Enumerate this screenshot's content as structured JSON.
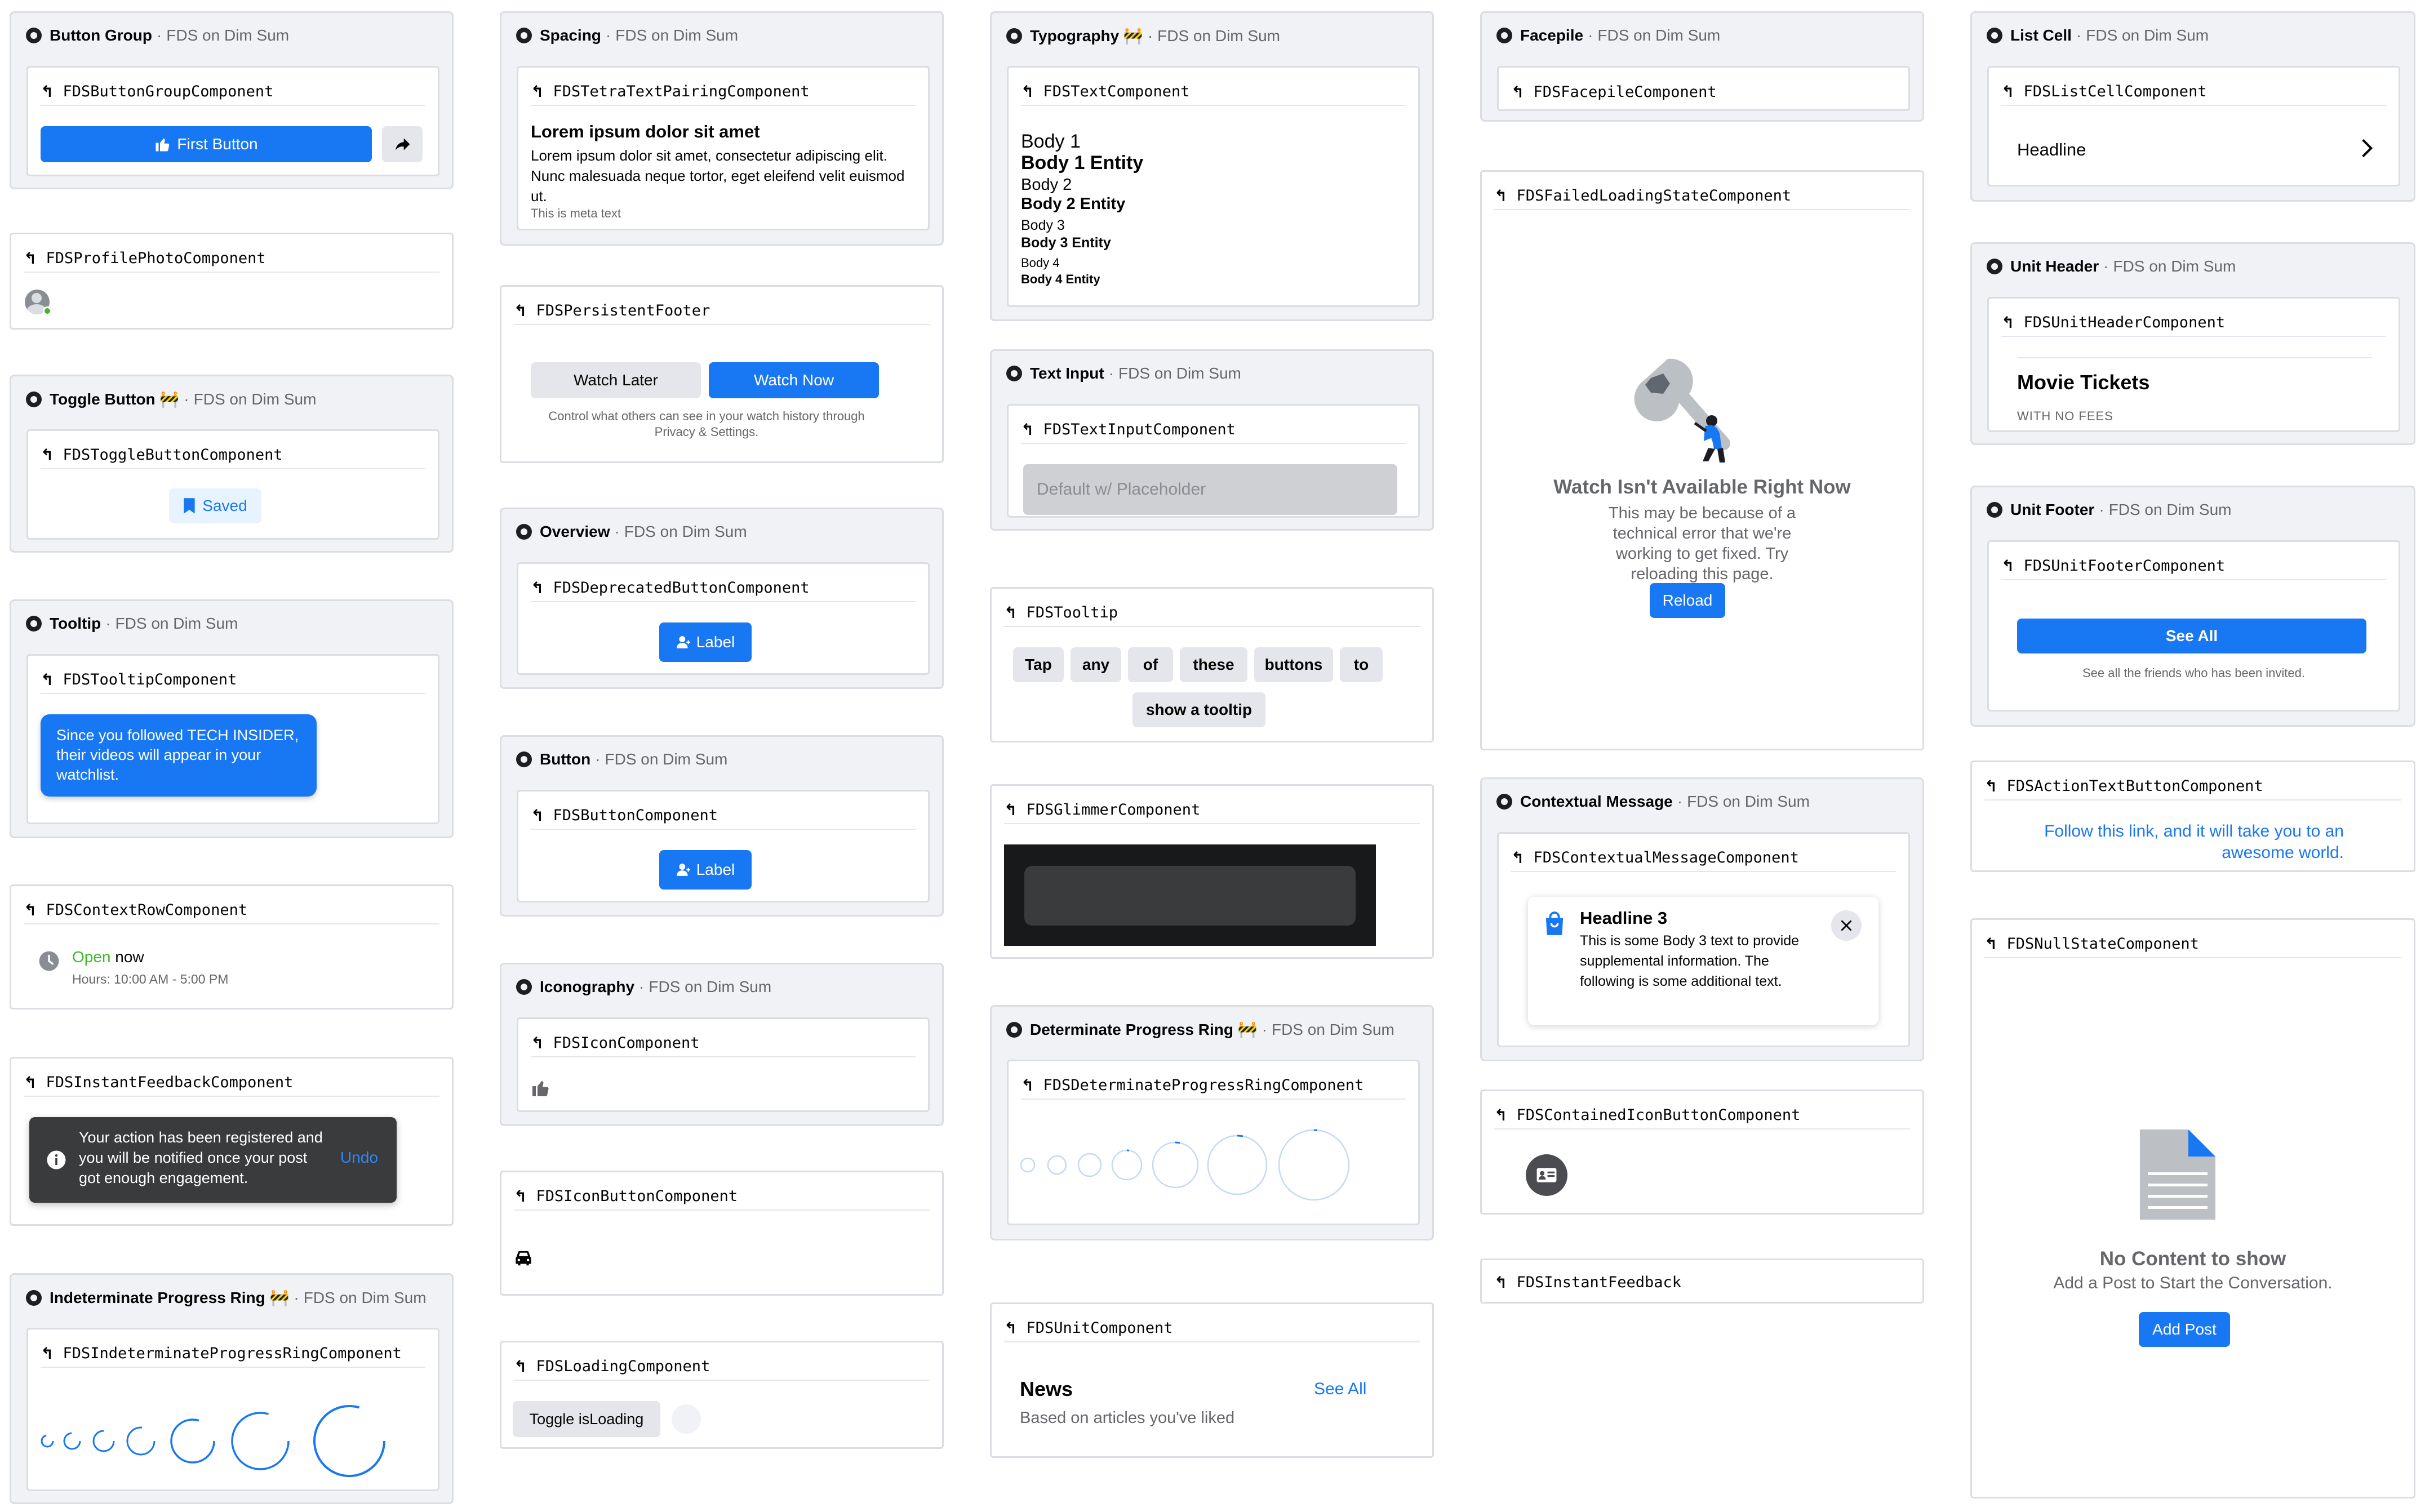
{
  "colors": {
    "accent": "#1877f2",
    "page_bg": "#ffffff",
    "card_bg": "#f0f2f5",
    "border": "#dadde1",
    "text": "#050505",
    "secondary": "#65676b",
    "positive": "#42b72a",
    "dark_toast": "#3a3b3c"
  },
  "sep": "·",
  "back_icon": "↰",
  "button_group": {
    "name": "Button Group",
    "suffix": "FDS on Dim Sum",
    "component": "FDSButtonGroupComponent",
    "primary_label": "First Button",
    "primary_icon": "thumbs-up-icon",
    "secondary_icon": "share-icon"
  },
  "profile_photo": {
    "component": "FDSProfilePhotoComponent"
  },
  "toggle_button": {
    "name": "Toggle Button 🚧",
    "suffix": "FDS on Dim Sum",
    "component": "FDSToggleButtonComponent",
    "label": "Saved",
    "icon": "bookmark-icon"
  },
  "tooltip": {
    "name": "Tooltip",
    "suffix": "FDS on Dim Sum",
    "component": "FDSTooltipComponent",
    "text": "Since you followed TECH INSIDER, their videos will appear in your watchlist."
  },
  "context_row": {
    "component": "FDSContextRowComponent",
    "status": "Open",
    "when": " now",
    "hours": "Hours: 10:00 AM - 5:00 PM",
    "icon": "clock-icon"
  },
  "instant_feedback_component": {
    "component": "FDSInstantFeedbackComponent",
    "text": "Your action has been registered and you will be notified once your post got enough engagement.",
    "action": "Undo",
    "icon": "info-icon"
  },
  "indeterminate_ring": {
    "name": "Indeterminate Progress Ring 🚧",
    "suffix": "FDS on Dim Sum",
    "component": "FDSIndeterminateProgressRingComponent"
  },
  "spacing": {
    "name": "Spacing",
    "suffix": "FDS on Dim Sum",
    "component": "FDSTetraTextPairingComponent",
    "headline": "Lorem ipsum dolor sit amet",
    "body": "Lorem ipsum dolor sit amet, consectetur adipiscing elit. Nunc malesuada neque tortor, eget eleifend velit euismod ut.",
    "meta": "This is meta text"
  },
  "persistent_footer": {
    "component": "FDSPersistentFooter",
    "secondary_label": "Watch Later",
    "primary_label": "Watch Now",
    "caption": "Control what others can see in your watch history through Privacy & Settings."
  },
  "overview": {
    "name": "Overview",
    "suffix": "FDS on Dim Sum",
    "component": "FDSDeprecatedButtonComponent",
    "label": "Label",
    "icon": "person-icon"
  },
  "button": {
    "name": "Button",
    "suffix": "FDS on Dim Sum",
    "component": "FDSButtonComponent",
    "label": "Label",
    "icon": "person-icon"
  },
  "iconography": {
    "name": "Iconography",
    "suffix": "FDS on Dim Sum",
    "component": "FDSIconComponent",
    "icon": "thumbs-up-icon"
  },
  "icon_button": {
    "component": "FDSIconButtonComponent",
    "icon": "car-icon"
  },
  "loading": {
    "component": "FDSLoadingComponent",
    "label": "Toggle isLoading"
  },
  "typography": {
    "name": "Typography 🚧",
    "suffix": "FDS on Dim Sum",
    "component": "FDSTextComponent",
    "lines": [
      "Body 1",
      "Body 1 Entity",
      "Body 2",
      "Body 2 Entity",
      "Body 3",
      "Body 3 Entity",
      "Body 4",
      "Body 4 Entity"
    ]
  },
  "text_input": {
    "name": "Text Input",
    "suffix": "FDS on Dim Sum",
    "component": "FDSTextInputComponent",
    "placeholder": "Default w/ Placeholder"
  },
  "tooltip_buttons": {
    "component": "FDSTooltip",
    "buttons": [
      "Tap",
      "any",
      "of",
      "these",
      "buttons",
      "to",
      "show a tooltip"
    ]
  },
  "glimmer": {
    "component": "FDSGlimmerComponent"
  },
  "determinate_ring": {
    "name": "Determinate Progress Ring 🚧",
    "suffix": "FDS on Dim Sum",
    "component": "FDSDeterminateProgressRingComponent"
  },
  "unit": {
    "component": "FDSUnitComponent",
    "title": "News",
    "link": "See All",
    "subtitle": "Based on articles you've liked"
  },
  "facepile": {
    "name": "Facepile",
    "suffix": "FDS on Dim Sum",
    "component": "FDSFacepileComponent"
  },
  "failed_loading": {
    "component": "FDSFailedLoadingStateComponent",
    "headline": "Watch Isn't Available Right Now",
    "body": "This may be because of a technical error that we're working to get fixed. Try reloading this page.",
    "button": "Reload",
    "illustration": "wrench-figure-icon"
  },
  "contextual_message": {
    "name": "Contextual Message",
    "suffix": "FDS on Dim Sum",
    "component": "FDSContextualMessageComponent",
    "headline": "Headline 3",
    "body": "This is some Body 3 text to provide supplemental information. The following is some additional text.",
    "icon": "shopping-bag-icon",
    "close_icon": "close-icon"
  },
  "contained_icon_button": {
    "component": "FDSContainedIconButtonComponent",
    "icon": "id-card-icon"
  },
  "instant_feedback": {
    "component": "FDSInstantFeedback"
  },
  "list_cell": {
    "name": "List Cell",
    "suffix": "FDS on Dim Sum",
    "component": "FDSListCellComponent",
    "headline": "Headline",
    "icon": "chevron-right-icon"
  },
  "unit_header": {
    "name": "Unit Header",
    "suffix": "FDS on Dim Sum",
    "component": "FDSUnitHeaderComponent",
    "title": "Movie Tickets",
    "meta": "WITH NO FEES"
  },
  "unit_footer": {
    "name": "Unit Footer",
    "suffix": "FDS on Dim Sum",
    "component": "FDSUnitFooterComponent",
    "button": "See All",
    "caption": "See all the friends who has been invited."
  },
  "action_text_button": {
    "component": "FDSActionTextButtonComponent",
    "text": "Follow this link, and it will take you to an awesome world."
  },
  "null_state": {
    "component": "FDSNullStateComponent",
    "headline": "No Content to show",
    "body": "Add a Post to Start the Conversation.",
    "button": "Add Post",
    "icon": "document-icon"
  }
}
